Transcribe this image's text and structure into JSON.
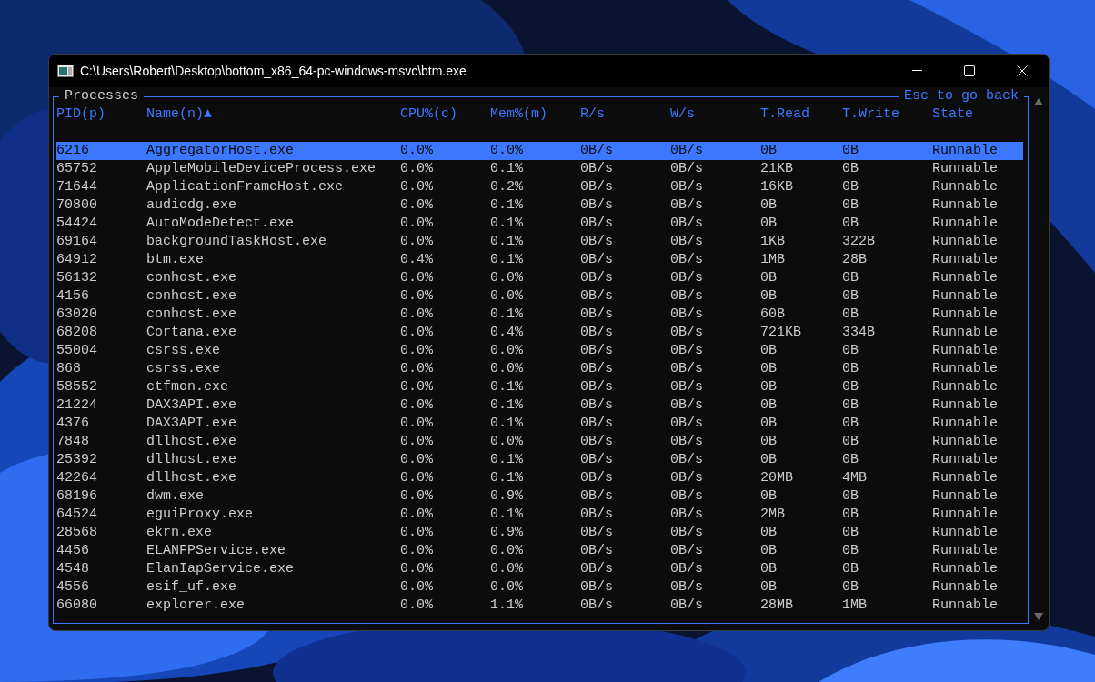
{
  "window": {
    "title": "C:\\Users\\Robert\\Desktop\\bottom_x86_64-pc-windows-msvc\\btm.exe"
  },
  "panel": {
    "title": "Processes",
    "hint": "Esc to go back"
  },
  "table": {
    "columns": [
      "PID(p)",
      "Name(n)▲",
      "CPU%(c)",
      "Mem%(m)",
      "R/s",
      "W/s",
      "T.Read",
      "T.Write",
      "State"
    ],
    "rows": [
      {
        "cells": [
          "6216",
          "AggregatorHost.exe",
          "0.0%",
          "0.0%",
          "0B/s",
          "0B/s",
          "0B",
          "0B",
          "Runnable"
        ],
        "selected": true
      },
      {
        "cells": [
          "65752",
          "AppleMobileDeviceProcess.exe",
          "0.0%",
          "0.1%",
          "0B/s",
          "0B/s",
          "21KB",
          "0B",
          "Runnable"
        ],
        "selected": false
      },
      {
        "cells": [
          "71644",
          "ApplicationFrameHost.exe",
          "0.0%",
          "0.2%",
          "0B/s",
          "0B/s",
          "16KB",
          "0B",
          "Runnable"
        ],
        "selected": false
      },
      {
        "cells": [
          "70800",
          "audiodg.exe",
          "0.0%",
          "0.1%",
          "0B/s",
          "0B/s",
          "0B",
          "0B",
          "Runnable"
        ],
        "selected": false
      },
      {
        "cells": [
          "54424",
          "AutoModeDetect.exe",
          "0.0%",
          "0.1%",
          "0B/s",
          "0B/s",
          "0B",
          "0B",
          "Runnable"
        ],
        "selected": false
      },
      {
        "cells": [
          "69164",
          "backgroundTaskHost.exe",
          "0.0%",
          "0.1%",
          "0B/s",
          "0B/s",
          "1KB",
          "322B",
          "Runnable"
        ],
        "selected": false
      },
      {
        "cells": [
          "64912",
          "btm.exe",
          "0.4%",
          "0.1%",
          "0B/s",
          "0B/s",
          "1MB",
          "28B",
          "Runnable"
        ],
        "selected": false
      },
      {
        "cells": [
          "56132",
          "conhost.exe",
          "0.0%",
          "0.0%",
          "0B/s",
          "0B/s",
          "0B",
          "0B",
          "Runnable"
        ],
        "selected": false
      },
      {
        "cells": [
          "4156",
          "conhost.exe",
          "0.0%",
          "0.0%",
          "0B/s",
          "0B/s",
          "0B",
          "0B",
          "Runnable"
        ],
        "selected": false
      },
      {
        "cells": [
          "63020",
          "conhost.exe",
          "0.0%",
          "0.1%",
          "0B/s",
          "0B/s",
          "60B",
          "0B",
          "Runnable"
        ],
        "selected": false
      },
      {
        "cells": [
          "68208",
          "Cortana.exe",
          "0.0%",
          "0.4%",
          "0B/s",
          "0B/s",
          "721KB",
          "334B",
          "Runnable"
        ],
        "selected": false
      },
      {
        "cells": [
          "55004",
          "csrss.exe",
          "0.0%",
          "0.0%",
          "0B/s",
          "0B/s",
          "0B",
          "0B",
          "Runnable"
        ],
        "selected": false
      },
      {
        "cells": [
          "868",
          "csrss.exe",
          "0.0%",
          "0.0%",
          "0B/s",
          "0B/s",
          "0B",
          "0B",
          "Runnable"
        ],
        "selected": false
      },
      {
        "cells": [
          "58552",
          "ctfmon.exe",
          "0.0%",
          "0.1%",
          "0B/s",
          "0B/s",
          "0B",
          "0B",
          "Runnable"
        ],
        "selected": false
      },
      {
        "cells": [
          "21224",
          "DAX3API.exe",
          "0.0%",
          "0.1%",
          "0B/s",
          "0B/s",
          "0B",
          "0B",
          "Runnable"
        ],
        "selected": false
      },
      {
        "cells": [
          "4376",
          "DAX3API.exe",
          "0.0%",
          "0.1%",
          "0B/s",
          "0B/s",
          "0B",
          "0B",
          "Runnable"
        ],
        "selected": false
      },
      {
        "cells": [
          "7848",
          "dllhost.exe",
          "0.0%",
          "0.0%",
          "0B/s",
          "0B/s",
          "0B",
          "0B",
          "Runnable"
        ],
        "selected": false
      },
      {
        "cells": [
          "25392",
          "dllhost.exe",
          "0.0%",
          "0.1%",
          "0B/s",
          "0B/s",
          "0B",
          "0B",
          "Runnable"
        ],
        "selected": false
      },
      {
        "cells": [
          "42264",
          "dllhost.exe",
          "0.0%",
          "0.1%",
          "0B/s",
          "0B/s",
          "20MB",
          "4MB",
          "Runnable"
        ],
        "selected": false
      },
      {
        "cells": [
          "68196",
          "dwm.exe",
          "0.0%",
          "0.9%",
          "0B/s",
          "0B/s",
          "0B",
          "0B",
          "Runnable"
        ],
        "selected": false
      },
      {
        "cells": [
          "64524",
          "eguiProxy.exe",
          "0.0%",
          "0.1%",
          "0B/s",
          "0B/s",
          "2MB",
          "0B",
          "Runnable"
        ],
        "selected": false
      },
      {
        "cells": [
          "28568",
          "ekrn.exe",
          "0.0%",
          "0.9%",
          "0B/s",
          "0B/s",
          "0B",
          "0B",
          "Runnable"
        ],
        "selected": false
      },
      {
        "cells": [
          "4456",
          "ELANFPService.exe",
          "0.0%",
          "0.0%",
          "0B/s",
          "0B/s",
          "0B",
          "0B",
          "Runnable"
        ],
        "selected": false
      },
      {
        "cells": [
          "4548",
          "ElanIapService.exe",
          "0.0%",
          "0.0%",
          "0B/s",
          "0B/s",
          "0B",
          "0B",
          "Runnable"
        ],
        "selected": false
      },
      {
        "cells": [
          "4556",
          "esif_uf.exe",
          "0.0%",
          "0.0%",
          "0B/s",
          "0B/s",
          "0B",
          "0B",
          "Runnable"
        ],
        "selected": false
      },
      {
        "cells": [
          "66080",
          "explorer.exe",
          "0.0%",
          "1.1%",
          "0B/s",
          "0B/s",
          "28MB",
          "1MB",
          "Runnable"
        ],
        "selected": false
      }
    ]
  }
}
